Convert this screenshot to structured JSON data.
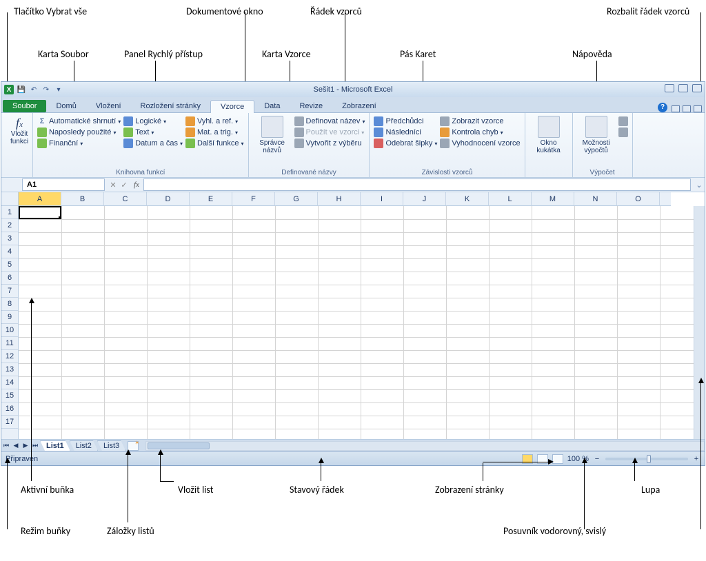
{
  "annotations": {
    "select_all_btn": "Tlačítko Vybrat vše",
    "file_tab": "Karta Soubor",
    "qat": "Panel Rychlý přístup",
    "doc_window": "Dokumentové okno",
    "formula_tab": "Karta Vzorce",
    "formula_bar": "Řádek vzorců",
    "ribbon": "Pás Karet",
    "help": "Nápověda",
    "expand_fb": "Rozbalit řádek vzorců",
    "active_cell": "Aktivní buňka",
    "cell_mode": "Režim buňky",
    "sheet_tabs": "Záložky listů",
    "insert_sheet": "Vložit list",
    "status_bar": "Stavový řádek",
    "page_view": "Zobrazení stránky",
    "scrollbars": "Posuvník vodorovný, svislý",
    "zoom": "Lupa"
  },
  "app": {
    "title_doc": "Sešit1",
    "title_app": "Microsoft Excel",
    "title_sep": " - "
  },
  "tabs": {
    "file": "Soubor",
    "home": "Domů",
    "insert": "Vložení",
    "layout": "Rozložení stránky",
    "formulas": "Vzorce",
    "data": "Data",
    "review": "Revize",
    "view": "Zobrazení"
  },
  "ribbon": {
    "insert_func": "Vložit\nfunkci",
    "lib": {
      "autosum": "Automatické shrnutí",
      "recent": "Naposledy použité",
      "financial": "Finanční",
      "logical": "Logické",
      "text": "Text",
      "datetime": "Datum a čas",
      "lookup": "Vyhl. a ref.",
      "math": "Mat. a trig.",
      "more": "Další funkce",
      "label": "Knihovna funkcí"
    },
    "names": {
      "mgr": "Správce\nnázvů",
      "define": "Definovat název",
      "use": "Použít ve vzorci",
      "from_sel": "Vytvořit z výběru",
      "label": "Definované názvy"
    },
    "audit": {
      "precedents": "Předchůdci",
      "dependents": "Následníci",
      "remove_arrows": "Odebrat šipky",
      "show_formulas": "Zobrazit vzorce",
      "error_check": "Kontrola chyb",
      "evaluate": "Vyhodnocení vzorce",
      "label": "Závislosti vzorců"
    },
    "watch": "Okno\nkukátka",
    "calc": {
      "options": "Možnosti\nvýpočtů",
      "label": "Výpočet"
    }
  },
  "namebox": "A1",
  "fx": "fx",
  "columns": [
    "A",
    "B",
    "C",
    "D",
    "E",
    "F",
    "G",
    "H",
    "I",
    "J",
    "K",
    "L",
    "M",
    "N",
    "O"
  ],
  "rows": [
    "1",
    "2",
    "3",
    "4",
    "5",
    "6",
    "7",
    "8",
    "9",
    "10",
    "11",
    "12",
    "13",
    "14",
    "15",
    "16",
    "17"
  ],
  "sheets": {
    "s1": "List1",
    "s2": "List2",
    "s3": "List3"
  },
  "status": {
    "mode": "Připraven",
    "zoom": "100 %"
  }
}
